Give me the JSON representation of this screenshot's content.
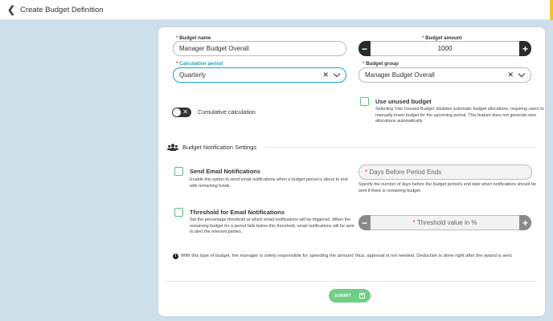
{
  "header": {
    "title": "Create Budget Definition",
    "back_icon": "chevron-left-icon"
  },
  "form": {
    "budget_name": {
      "label": "Budget name",
      "value": "Manager Budget Overall"
    },
    "budget_amount": {
      "label": "Budget amount",
      "value": "1000",
      "minus": "−",
      "plus": "+"
    },
    "calculation_period": {
      "label": "Calculation period",
      "value": "Quarterly"
    },
    "budget_group": {
      "label": "Budget group",
      "value": "Manager Budget Overall"
    },
    "cumulative": {
      "label": "Cumulative calculation",
      "enabled": false
    },
    "use_unused": {
      "label": "Use unused budget",
      "checked": false,
      "help": "Selecting 'Use Unused Budget' disables automatic budget allocations, requiring users to manually insert budget for the upcoming period. This feature does not generate new allocations automatically."
    }
  },
  "notifications": {
    "section_title": "Budget Notification Settings",
    "send_email": {
      "label": "Send Email Notifications",
      "checked": false,
      "help": "Enable this option to send email notifications when a budget period is about to end with remaining funds."
    },
    "days_before": {
      "placeholder": "Days Before Period Ends",
      "help": "Specify the number of days before the budget period's end date when notifications should be sent if there is remaining budget."
    },
    "threshold": {
      "label": "Threshold for Email Notifications",
      "checked": false,
      "help": "Set the percentage threshold at which email notifications will be triggered. When the remaining budget for a period falls below this threshold, email notifications will be sent to alert the relevant parties.",
      "placeholder": "Threshold value in %",
      "minus": "−",
      "plus": "+"
    }
  },
  "note": "With this type of budget, the manager is solely responsible for spending the amount; thus, approval is not needed. Deduction is done right after the award is sent.",
  "submit": {
    "label": "SUBMIT"
  },
  "colors": {
    "accent_blue": "#1aa3c9",
    "success_green": "#6fcf86",
    "required_red": "#e0383f",
    "background": "#cfdfe9"
  }
}
